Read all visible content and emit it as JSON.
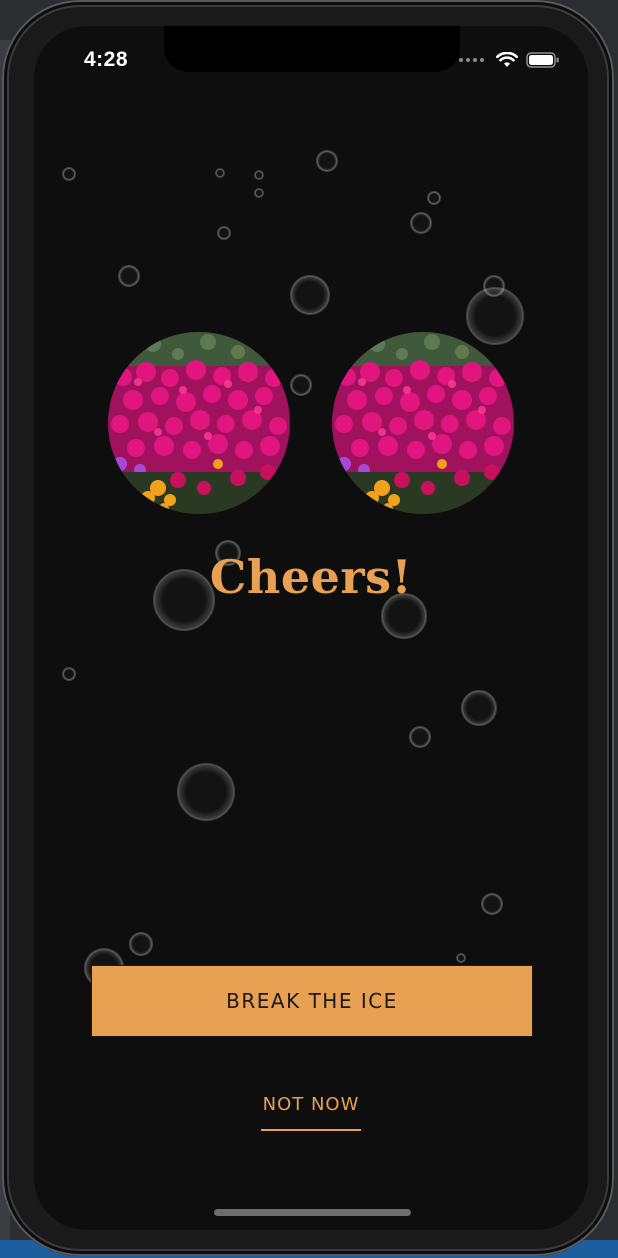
{
  "status_bar": {
    "time": "4:28",
    "icons": [
      "cellular-signal-icon",
      "wifi-icon",
      "battery-icon"
    ]
  },
  "photos": {
    "left": "flower-field-photo",
    "right": "flower-field-photo"
  },
  "headline": "Cheers!",
  "actions": {
    "primary_label": "BREAK THE ICE",
    "secondary_label": "NOT NOW"
  },
  "colors": {
    "accent": "#E8A053",
    "background": "#0E0E0E",
    "primary_text": "#1A1A1A"
  }
}
